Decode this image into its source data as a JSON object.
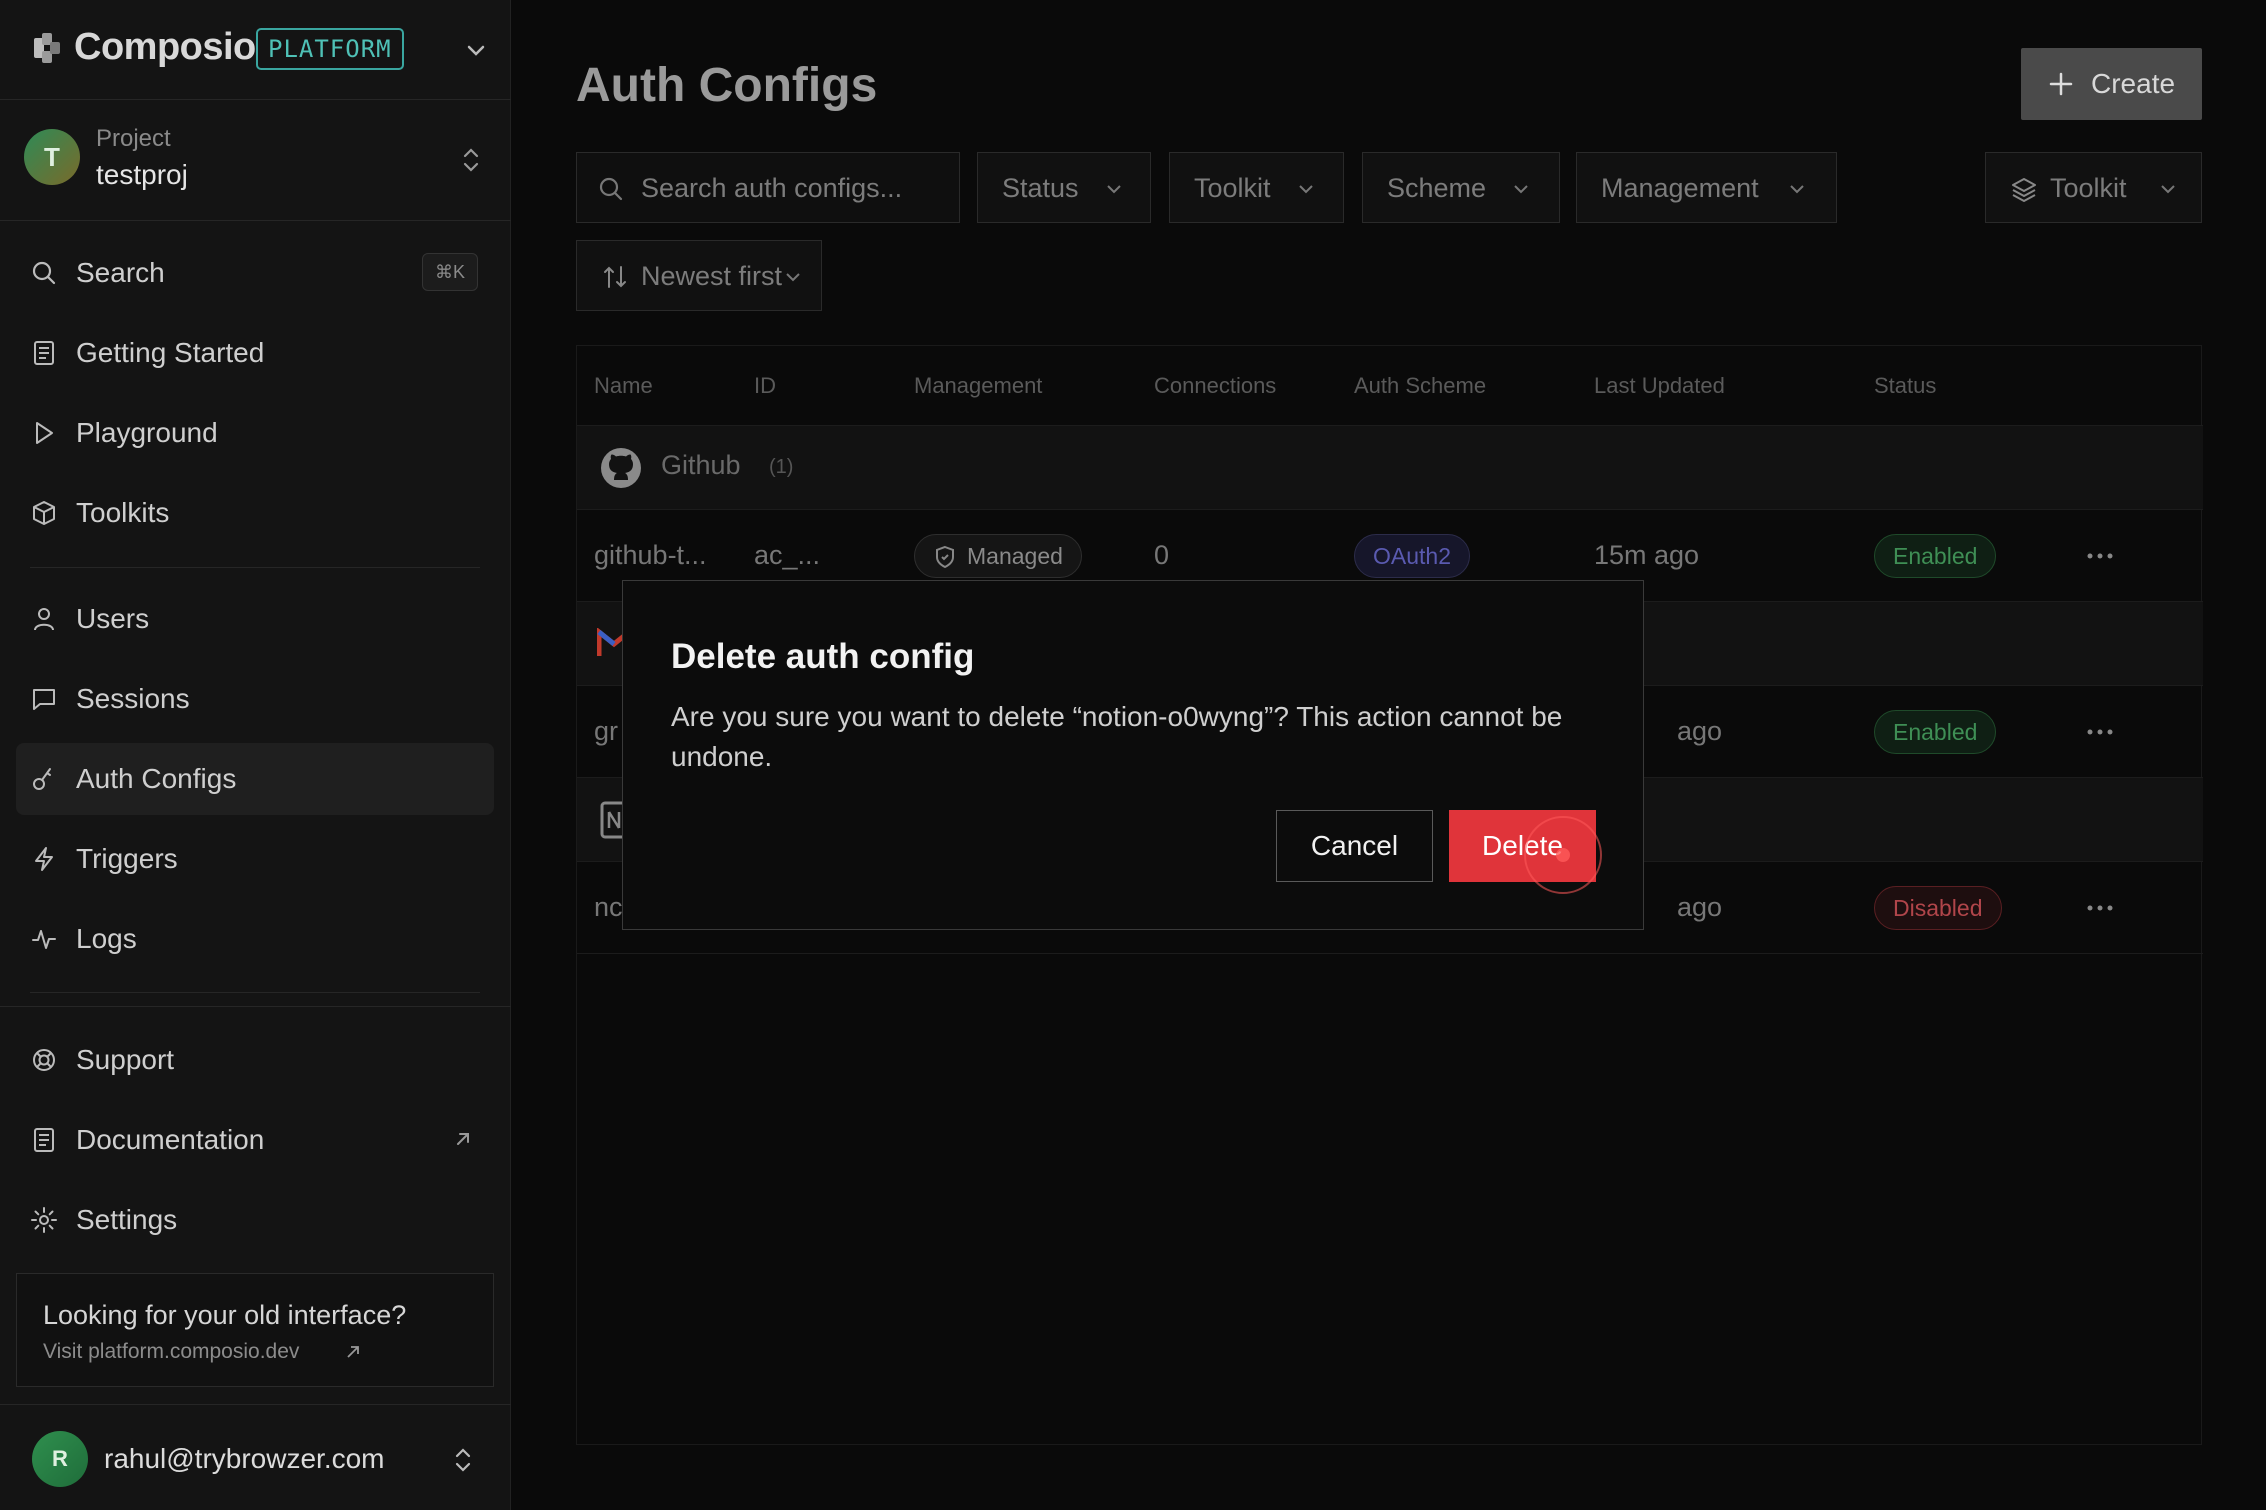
{
  "brand": {
    "name": "Composio",
    "badge": "PLATFORM"
  },
  "project": {
    "label": "Project",
    "name": "testproj",
    "avatar_letter": "T"
  },
  "sidebar": {
    "search": {
      "label": "Search",
      "shortcut": "⌘K"
    },
    "items": [
      {
        "label": "Getting Started",
        "icon": "document-icon"
      },
      {
        "label": "Playground",
        "icon": "play-icon"
      },
      {
        "label": "Toolkits",
        "icon": "cube-icon"
      },
      {
        "label": "Users",
        "icon": "user-icon"
      },
      {
        "label": "Sessions",
        "icon": "chat-icon"
      },
      {
        "label": "Auth Configs",
        "icon": "key-icon",
        "active": true
      },
      {
        "label": "Triggers",
        "icon": "bolt-icon"
      },
      {
        "label": "Logs",
        "icon": "activity-icon"
      },
      {
        "label": "Support",
        "icon": "lifebuoy-icon"
      },
      {
        "label": "Documentation",
        "icon": "document-icon"
      },
      {
        "label": "Settings",
        "icon": "gear-icon"
      }
    ],
    "old_interface": {
      "title": "Looking for your old interface?",
      "link": "Visit platform.composio.dev"
    },
    "user": {
      "email": "rahul@trybrowzer.com",
      "avatar_letter": "R"
    }
  },
  "main": {
    "title": "Auth Configs",
    "create_label": "Create",
    "search_placeholder": "Search auth configs...",
    "filters": {
      "status": "Status",
      "toolkit": "Toolkit",
      "scheme": "Scheme",
      "management": "Management",
      "toolkit_group": "Toolkit"
    },
    "sort": "Newest first",
    "table": {
      "columns": [
        "Name",
        "ID",
        "Management",
        "Connections",
        "Auth Scheme",
        "Last Updated",
        "Status"
      ],
      "groups": [
        {
          "name": "Github",
          "count": "(1)",
          "rows": [
            {
              "name": "github-t...",
              "id": "ac_...",
              "management": "Managed",
              "connections": "0",
              "scheme": "OAuth2",
              "updated": "15m ago",
              "status": "Enabled"
            }
          ]
        },
        {
          "rows": [
            {
              "name": "gr",
              "updated": "ago",
              "status": "Enabled"
            }
          ]
        },
        {
          "rows": [
            {
              "name": "nc",
              "updated": "ago",
              "status": "Disabled"
            }
          ]
        }
      ]
    }
  },
  "modal": {
    "title": "Delete auth config",
    "body": "Are you sure you want to delete “notion-o0wyng”? This action cannot be undone.",
    "cancel": "Cancel",
    "delete": "Delete"
  },
  "colors": {
    "danger": "#e0343a",
    "accent_teal": "#4fc1b6",
    "enabled_green": "#3f8f55",
    "disabled_red": "#b0454a",
    "oauth_purple": "#5a5ab0"
  }
}
